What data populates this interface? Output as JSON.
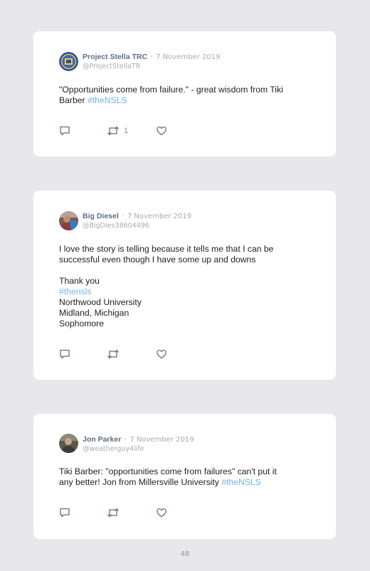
{
  "tweets": [
    {
      "name": "Project Stella TRC",
      "separator": "·",
      "date": "7 November 2019",
      "handle": "@ProjectStellaTR",
      "lines": [
        {
          "text": "\"Opportunities come from failure.\" - great wisdom from Tiki"
        },
        {
          "text": "Barber ",
          "tag": "#theNSLS"
        }
      ],
      "retweets": "1",
      "avatar_icon": "seal-logo"
    },
    {
      "name": "Big Diesel",
      "separator": "·",
      "date": "7 November 2019",
      "handle": "@BigDies38604496",
      "lines": [
        {
          "text": "I love the story is telling because it tells me that I can be"
        },
        {
          "text": "successful even though I have some up and downs"
        },
        {
          "text": ""
        },
        {
          "text": "Thank you"
        },
        {
          "text": "",
          "tag": "#thensls"
        },
        {
          "text": "Northwood University"
        },
        {
          "text": "Midland, Michigan"
        },
        {
          "text": "Sophomore"
        }
      ],
      "retweets": "",
      "avatar_icon": "person-photo"
    },
    {
      "name": "Jon Parker",
      "separator": "·",
      "date": "7 November 2019",
      "handle": "@weatherguy4life",
      "lines": [
        {
          "text": "Tiki Barber: \"opportunities come from failures\" can't put it"
        },
        {
          "text": "any better! Jon from Millersville University ",
          "tag": "#theNSLS"
        }
      ],
      "retweets": "",
      "avatar_icon": "person-photo"
    }
  ],
  "page_number": "48",
  "icons": {
    "reply": "reply-icon",
    "retweet": "retweet-icon",
    "like": "heart-icon"
  },
  "colors": {
    "background": "#e8e8ec",
    "card": "#ffffff",
    "name": "#5f6f82",
    "meta": "#a3acb6",
    "hashtag": "#6fb6e0",
    "icon": "#5f6f82"
  }
}
